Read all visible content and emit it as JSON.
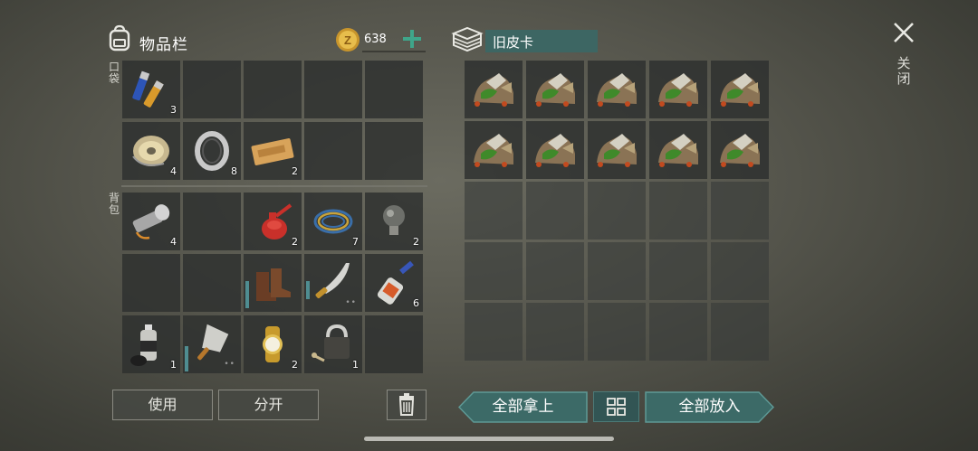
{
  "header": {
    "inventory_title": "物品栏",
    "coin_value": "638",
    "container_name": "旧皮卡",
    "close_label": "关闭"
  },
  "sections": {
    "pocket_label": "口袋",
    "backpack_label": "背包"
  },
  "pocket_items": [
    {
      "name": "batteries",
      "count": "3"
    },
    {
      "name": "empty",
      "count": ""
    },
    {
      "name": "empty",
      "count": ""
    },
    {
      "name": "empty",
      "count": ""
    },
    {
      "name": "empty",
      "count": ""
    },
    {
      "name": "wire-spool",
      "count": "4"
    },
    {
      "name": "bearing",
      "count": "8"
    },
    {
      "name": "coupon",
      "count": "2"
    },
    {
      "name": "empty",
      "count": ""
    },
    {
      "name": "empty",
      "count": ""
    }
  ],
  "backpack_items": [
    {
      "name": "flashlight",
      "count": "4"
    },
    {
      "name": "empty",
      "count": ""
    },
    {
      "name": "oil-can",
      "count": "2"
    },
    {
      "name": "cable-coil",
      "count": "7"
    },
    {
      "name": "light-bulb",
      "count": "2"
    },
    {
      "name": "empty",
      "count": ""
    },
    {
      "name": "empty",
      "count": ""
    },
    {
      "name": "boots",
      "count": ""
    },
    {
      "name": "machete",
      "count": ""
    },
    {
      "name": "glue-tube",
      "count": "6"
    },
    {
      "name": "spray-paint",
      "count": "1"
    },
    {
      "name": "cleaver",
      "count": ""
    },
    {
      "name": "wristwatch",
      "count": "2"
    },
    {
      "name": "padlock-and-key",
      "count": "1"
    },
    {
      "name": "empty",
      "count": ""
    }
  ],
  "container_items": {
    "filled_item": "scrap-pile",
    "filled_count": 10,
    "total_cells": 25
  },
  "buttons": {
    "use": "使用",
    "split": "分开",
    "take_all": "全部拿上",
    "put_all": "全部放入"
  },
  "colors": {
    "accent_teal": "#3d6663",
    "button_teal": "#3c6a67",
    "coin_gold": "#d6a93a",
    "plus_green": "#3fa58a"
  }
}
